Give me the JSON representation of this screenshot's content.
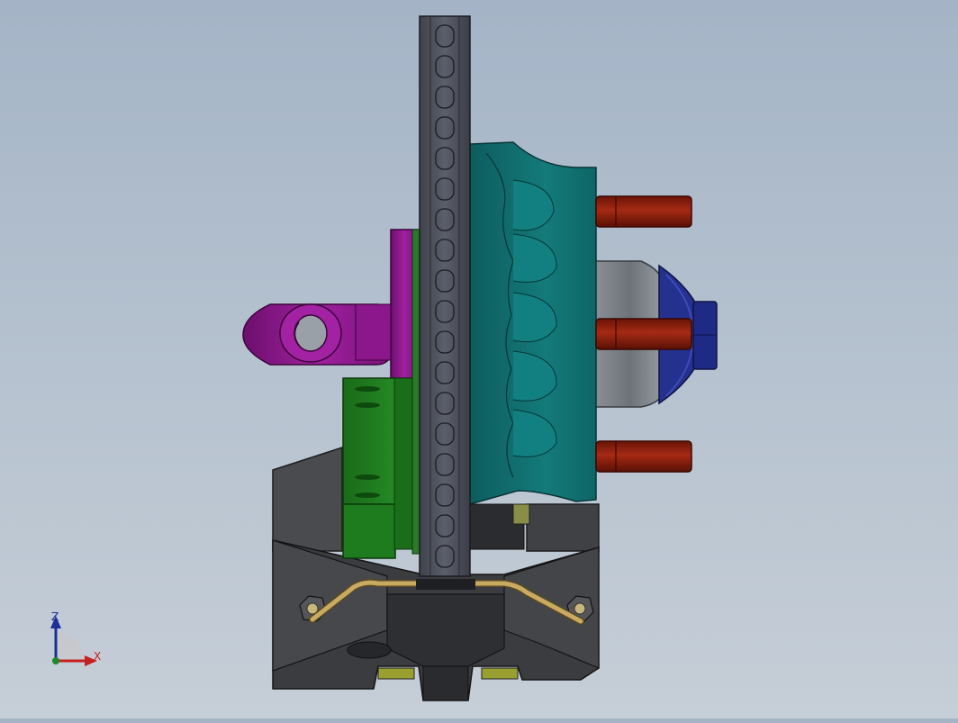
{
  "triad": {
    "z_label": "Z",
    "x_label": "X",
    "colors": {
      "z": "#1b2f9a",
      "x": "#c42020",
      "y": "#1a8a2a"
    }
  },
  "colors": {
    "background_top": "#a4b4c6",
    "background_bottom": "#c6ced7",
    "rotor": "#4c4f5a",
    "caliper": "#0f6a6a",
    "bracket_purple": "#8a1a8a",
    "green_block": "#1e7a1e",
    "red_pins": "#8a1e10",
    "blue_nut": "#1d2a8a",
    "hub_grey": "#7c8088",
    "base_dark": "#3a3b3e",
    "brass_line": "#b79a55"
  },
  "icons": [
    "coordinate-triad-icon"
  ]
}
